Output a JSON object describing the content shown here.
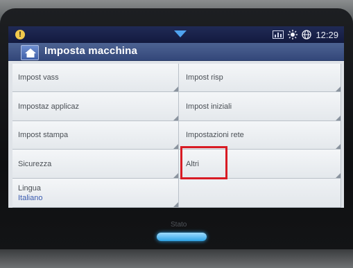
{
  "status_bar": {
    "alert_symbol": "!",
    "time": "12:29",
    "icons": [
      "alert-icon",
      "chevron-down-icon",
      "usage-chart-icon",
      "sun-icon",
      "globe-icon"
    ]
  },
  "header": {
    "title": "Imposta macchina"
  },
  "menu": {
    "left": [
      {
        "label": "Impost vass"
      },
      {
        "label": "Impostaz applicaz"
      },
      {
        "label": "Impost stampa"
      },
      {
        "label": "Sicurezza"
      },
      {
        "label": "Lingua",
        "value": "Italiano"
      }
    ],
    "right": [
      {
        "label": "Impost risp"
      },
      {
        "label": "Impost iniziali"
      },
      {
        "label": "Impostazioni rete"
      },
      {
        "label": "Altri"
      },
      {
        "label": ""
      }
    ]
  },
  "device": {
    "status_label": "Stato"
  },
  "colors": {
    "status_bar": "#131a3f",
    "title_bar": "#3f5588",
    "highlight": "#d81b24",
    "led": "#2ea3e6"
  }
}
